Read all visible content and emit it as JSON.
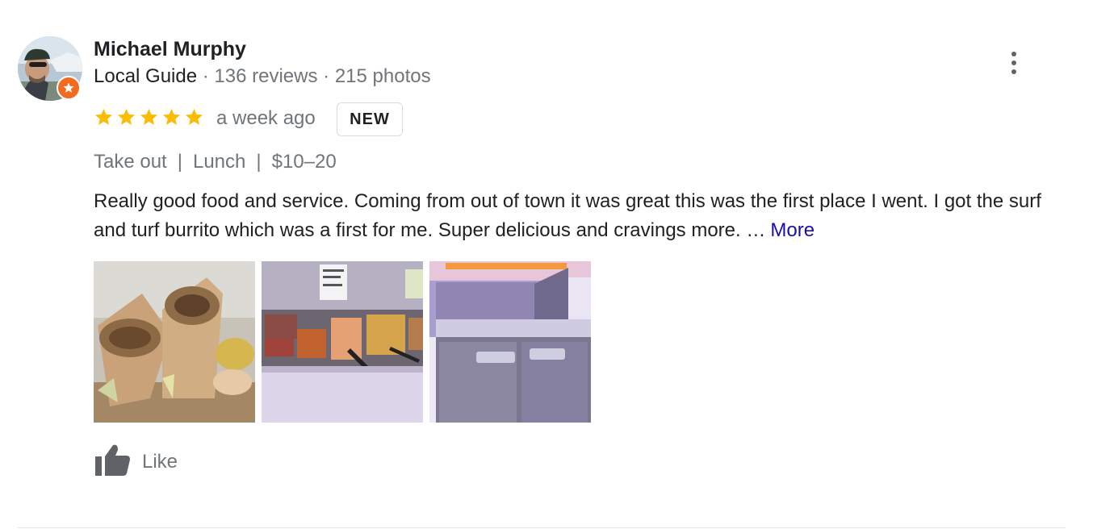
{
  "reviewer": {
    "name": "Michael Murphy",
    "level": "Local Guide",
    "reviews": "· 136 reviews",
    "photos": "· 215 photos"
  },
  "rating": {
    "stars": 5,
    "max": 5,
    "time": "a week ago",
    "badge": "NEW"
  },
  "tags": {
    "mode": "Take out",
    "meal": "Lunch",
    "price": "$10–20",
    "separator": "|"
  },
  "review_text": "Really good food and service. Coming from out of town it was great this was the first place I went. I got the surf and turf burrito which was a first for me. Super delicious and cravings more. …",
  "more_label": "More",
  "like_label": "Like",
  "colors": {
    "star": "#fbbc04",
    "link": "#1a0dab",
    "badge_orange": "#f26b21",
    "secondary_text": "#70757a"
  },
  "icons": {
    "menu": "more-vert-icon",
    "like": "thumb-up-icon",
    "star": "star-icon",
    "guide_badge": "local-guide-star-icon"
  }
}
